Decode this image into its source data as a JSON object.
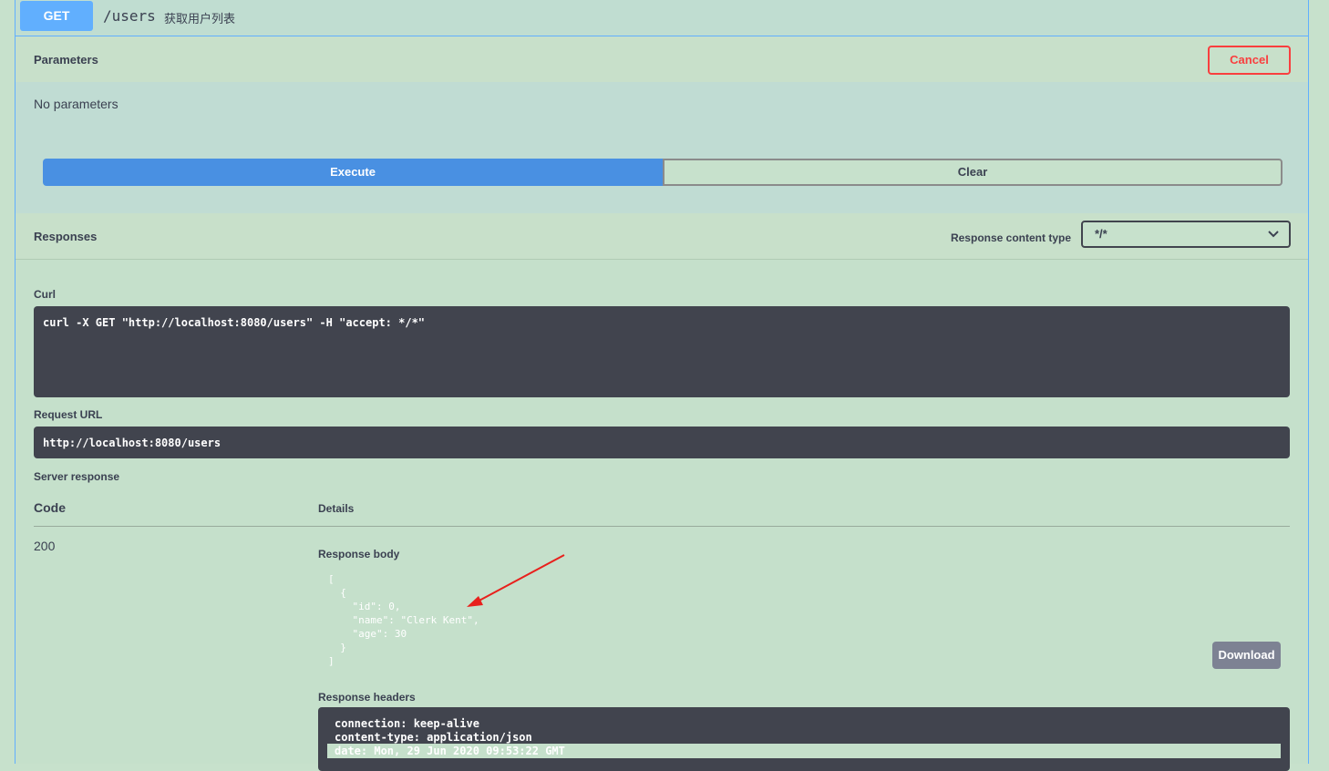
{
  "operation": {
    "method": "GET",
    "path": "/users",
    "description": "获取用户列表"
  },
  "parameters": {
    "title": "Parameters",
    "cancel_label": "Cancel",
    "empty_text": "No parameters",
    "execute_label": "Execute",
    "clear_label": "Clear"
  },
  "responses": {
    "title": "Responses",
    "content_type_label": "Response content type",
    "content_type_value": "*/*"
  },
  "curl": {
    "label": "Curl",
    "command": "curl -X GET \"http://localhost:8080/users\" -H \"accept: */*\""
  },
  "request_url": {
    "label": "Request URL",
    "value": "http://localhost:8080/users"
  },
  "server_response": {
    "label": "Server response",
    "code_header": "Code",
    "details_header": "Details",
    "code": "200",
    "body_label": "Response body",
    "body": "[\n  {\n    \"id\": 0,\n    \"name\": \"Clerk Kent\",\n    \"age\": 30\n  }\n]",
    "download_label": "Download",
    "headers_label": "Response headers",
    "headers": [
      "connection: keep-alive",
      "content-type: application/json",
      "date: Mon, 29 Jun 2020 09:53:22 GMT"
    ]
  },
  "colors": {
    "get_method": "#61affe",
    "execute": "#4990e2",
    "cancel": "#f93e3e",
    "annotation_arrow": "#e8201c"
  }
}
